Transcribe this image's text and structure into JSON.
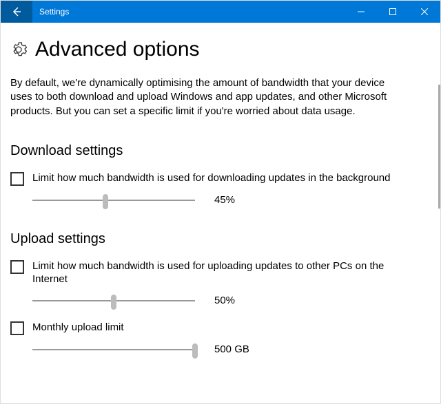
{
  "window": {
    "title": "Settings"
  },
  "page": {
    "heading": "Advanced options",
    "description": "By default, we're dynamically optimising the amount of bandwidth that your device uses to both download and upload Windows and app updates, and other Microsoft products. But you can set a specific limit if you're worried about data usage."
  },
  "download": {
    "section_title": "Download settings",
    "limit_label": "Limit how much bandwidth is used for downloading updates in the background",
    "limit_checked": false,
    "slider_percent": 45,
    "slider_display": "45%"
  },
  "upload": {
    "section_title": "Upload settings",
    "limit_label": "Limit how much bandwidth is used for uploading updates to other PCs on the Internet",
    "limit_checked": false,
    "slider_percent": 50,
    "slider_display": "50%",
    "monthly_label": "Monthly upload limit",
    "monthly_checked": false,
    "monthly_slider_percent": 100,
    "monthly_display": "500 GB"
  },
  "colors": {
    "accent": "#0078d7",
    "accent_dark": "#005a9e"
  }
}
